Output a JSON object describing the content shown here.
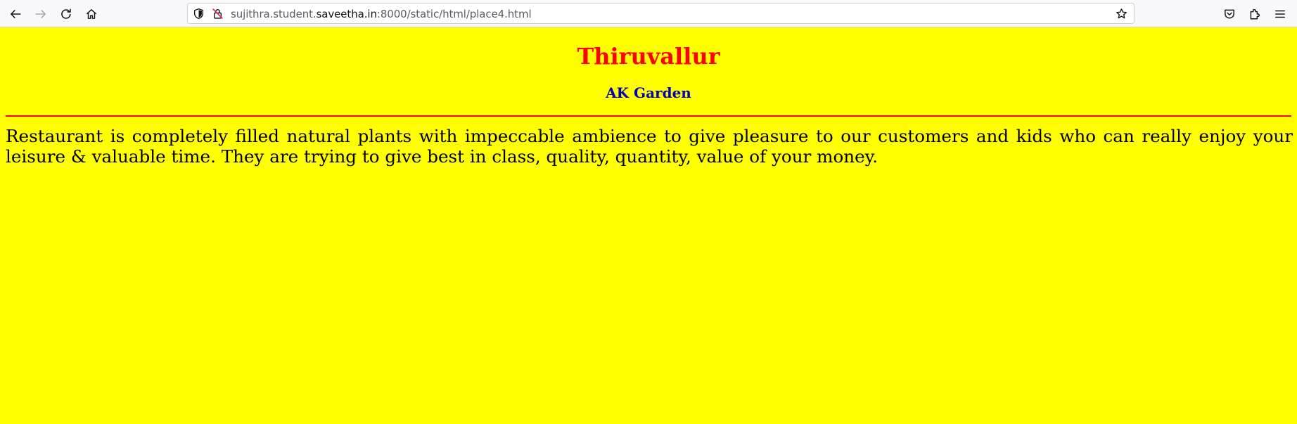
{
  "browser": {
    "address_bar": {
      "url_host_prefix": "sujithra.student.",
      "url_host_domain": "saveetha.in",
      "url_path": ":8000/static/html/place4.html"
    },
    "icons": {
      "back": "arrow-left-icon",
      "forward": "arrow-right-icon",
      "reload": "reload-icon",
      "home": "home-icon",
      "tracking_protection": "shield-icon",
      "insecure_connection": "lock-crossed-icon",
      "bookmark": "star-icon",
      "pocket": "pocket-icon",
      "extensions": "puzzle-icon",
      "menu": "hamburger-menu-icon"
    }
  },
  "page": {
    "background_color": "#ffff00",
    "title": "Thiruvallur",
    "title_color": "#ff0000",
    "subtitle": "AK Garden",
    "subtitle_color": "#0000b8",
    "rule_color": "#ff0000",
    "description": "Restaurant is completely filled natural plants with impeccable ambience to give pleasure to our customers and kids who can really enjoy your leisure & valuable time. They are trying to give best in class, quality, quantity, value of your money."
  }
}
